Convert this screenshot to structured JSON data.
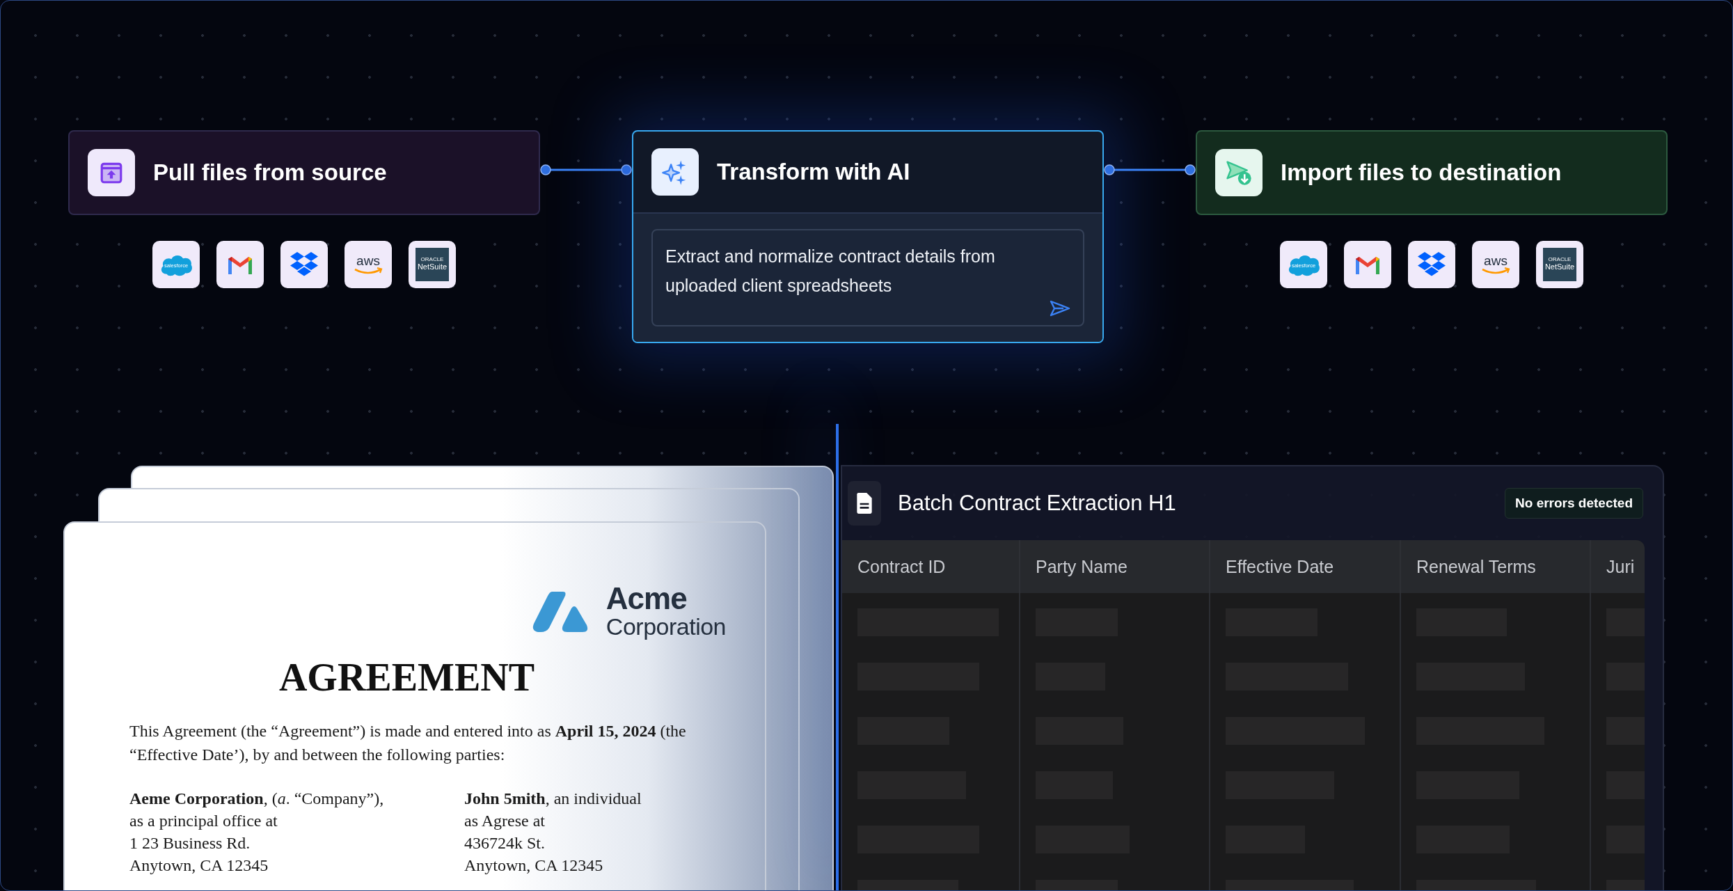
{
  "nodes": [
    {
      "kind": "source",
      "title": "Pull files from source",
      "integrations": [
        {
          "kind": "salesforce",
          "label": "salesforce"
        },
        {
          "kind": "gmail"
        },
        {
          "kind": "dropbox"
        },
        {
          "kind": "aws",
          "label": "aws"
        },
        {
          "kind": "netsuite",
          "label": "NetSuite",
          "caption": "ORACLE"
        }
      ]
    },
    {
      "kind": "ai",
      "title": "Transform with AI",
      "prompt": "Extract and normalize contract details from uploaded client spreadsheets"
    },
    {
      "kind": "destination",
      "title": "Import files to destination",
      "integrations": [
        {
          "kind": "salesforce",
          "label": "salesforce"
        },
        {
          "kind": "gmail"
        },
        {
          "kind": "dropbox"
        },
        {
          "kind": "aws",
          "label": "aws"
        },
        {
          "kind": "netsuite",
          "label": "NetSuite",
          "caption": "ORACLE"
        }
      ]
    }
  ],
  "document": {
    "logo": {
      "name": "Acme",
      "subtitle": "Corporation"
    },
    "title": "AGREEMENT",
    "intro": "This Agreement (the “Agreement”) is made and entered into as **April 15, 2024** (the “Effective Date’), by and between the following parties:",
    "parties": [
      {
        "lines": [
          "**Aeme Corporation**, (*a*. “Company”),",
          "as a principal office at",
          "1 23 Business Rd.",
          "Anytown, CA 12345"
        ]
      },
      {
        "lines": [
          "**John 5mith**, an individual",
          "as Agrese at",
          "436724k St.",
          "Anytown, CA 12345"
        ]
      }
    ]
  },
  "batch": {
    "title": "Batch Contract Extraction H1",
    "badge": "No errors detected",
    "columns": [
      "Contract ID",
      "Party Name",
      "Effective Date",
      "Renewal Terms",
      "Juri"
    ]
  }
}
